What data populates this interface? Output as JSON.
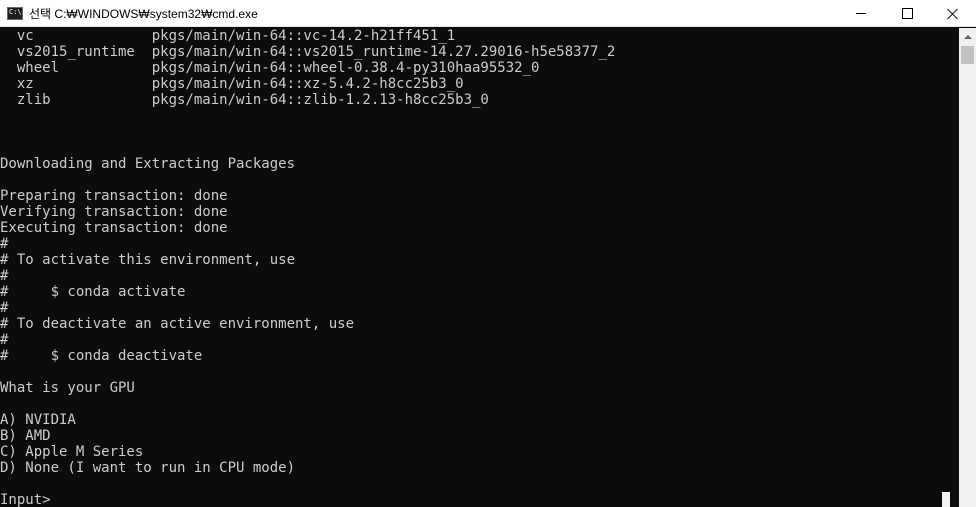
{
  "window": {
    "title": "선택 C:₩WINDOWS₩system32₩cmd.exe",
    "icon_text": "C:\\"
  },
  "console": {
    "lines": [
      "  vc              pkgs/main/win-64::vc-14.2-h21ff451_1",
      "  vs2015_runtime  pkgs/main/win-64::vs2015_runtime-14.27.29016-h5e58377_2",
      "  wheel           pkgs/main/win-64::wheel-0.38.4-py310haa95532_0",
      "  xz              pkgs/main/win-64::xz-5.4.2-h8cc25b3_0",
      "  zlib            pkgs/main/win-64::zlib-1.2.13-h8cc25b3_0",
      "",
      "",
      "",
      "Downloading and Extracting Packages",
      "",
      "Preparing transaction: done",
      "Verifying transaction: done",
      "Executing transaction: done",
      "#",
      "# To activate this environment, use",
      "#",
      "#     $ conda activate",
      "#",
      "# To deactivate an active environment, use",
      "#",
      "#     $ conda deactivate",
      "",
      "What is your GPU",
      "",
      "A) NVIDIA",
      "B) AMD",
      "C) Apple M Series",
      "D) None (I want to run in CPU mode)",
      "",
      "Input>"
    ]
  }
}
